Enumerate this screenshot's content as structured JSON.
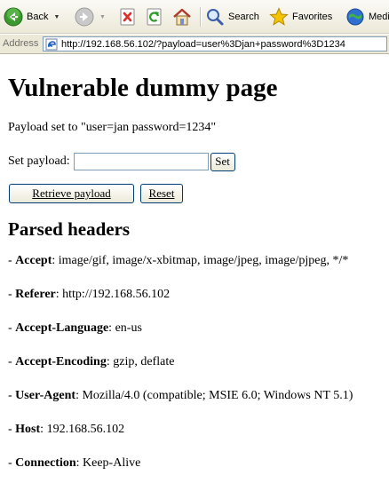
{
  "toolbar": {
    "back_label": "Back",
    "search_label": "Search",
    "favorites_label": "Favorites",
    "media_label": "Medi"
  },
  "address_bar": {
    "label": "Address",
    "url": "http://192.168.56.102/?payload=user%3Djan+password%3D1234"
  },
  "page": {
    "title": "Vulnerable dummy page",
    "payload_status": "Payload set to \"user=jan password=1234\"",
    "set_payload_label": "Set payload:",
    "payload_input_value": "",
    "set_button": "Set",
    "retrieve_button": "Retrieve payload",
    "reset_button": "Reset",
    "parsed_headers_title": "Parsed headers",
    "headers": [
      {
        "prefix": "- ",
        "name": "Accept",
        "sep": ": ",
        "value": "image/gif, image/x-xbitmap, image/jpeg, image/pjpeg, */*"
      },
      {
        "prefix": "- ",
        "name": "Referer",
        "sep": ": ",
        "value": "http://192.168.56.102"
      },
      {
        "prefix": "- ",
        "name": "Accept-Language",
        "sep": ": ",
        "value": "en-us"
      },
      {
        "prefix": "- ",
        "name": "Accept-Encoding",
        "sep": ": ",
        "value": "gzip, deflate"
      },
      {
        "prefix": "- ",
        "name": "User-Agent",
        "sep": ": ",
        "value": "Mozilla/4.0 (compatible; MSIE 6.0; Windows NT 5.1)"
      },
      {
        "prefix": "- ",
        "name": "Host",
        "sep": ": ",
        "value": "192.168.56.102"
      },
      {
        "prefix": "- ",
        "name": "Connection",
        "sep": ": ",
        "value": "Keep-Alive"
      }
    ]
  },
  "icons": {
    "back": "back-arrow-icon",
    "forward": "forward-arrow-icon",
    "stop": "stop-icon",
    "refresh": "refresh-icon",
    "home": "home-icon",
    "search": "search-icon",
    "favorites": "favorites-star-icon",
    "media": "media-icon",
    "page": "ie-page-icon"
  },
  "colors": {
    "nav_green": "#3b9a2f",
    "stop_red": "#d8302a",
    "star_yellow": "#f5c400",
    "chrome_bg": "#ece9d8",
    "button_border": "#003c74"
  }
}
